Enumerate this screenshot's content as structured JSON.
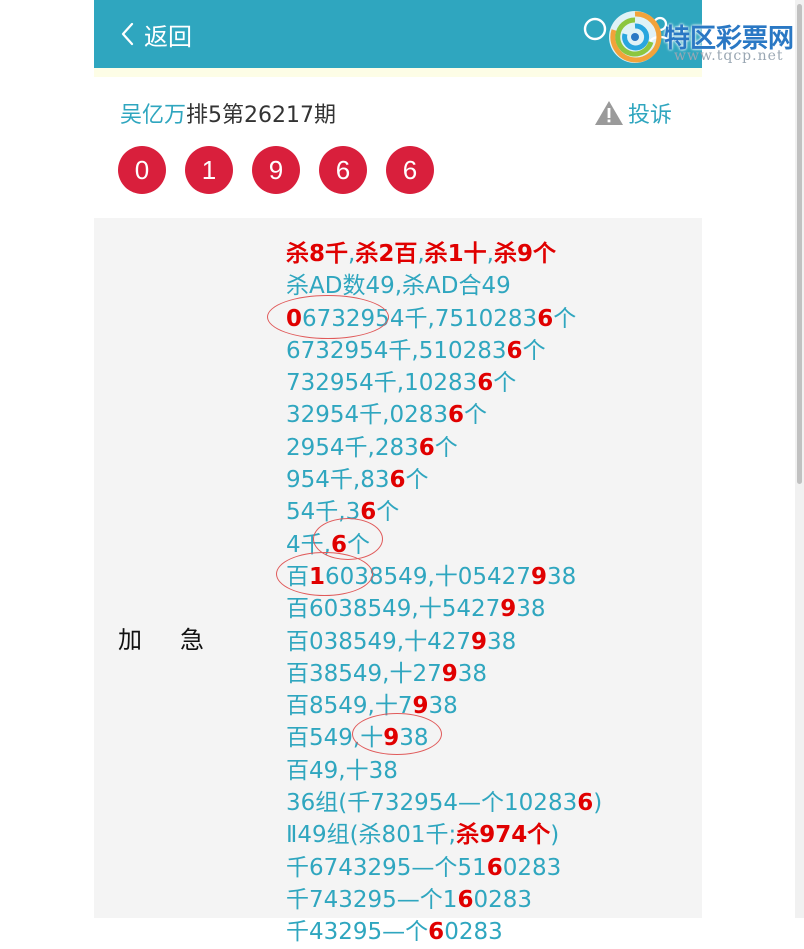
{
  "header": {
    "back_label": "返回",
    "background_color": "#2fa6bf"
  },
  "logo": {
    "title": "特区彩票网",
    "url": "www.tqcp.net"
  },
  "article": {
    "author": "吴亿万",
    "title_suffix": "排5第26217期",
    "complain_label": "投诉"
  },
  "draw_numbers": [
    "0",
    "1",
    "9",
    "6",
    "6"
  ],
  "content": {
    "label": "加急",
    "lines": [
      [
        {
          "t": "杀8千",
          "r": true
        },
        {
          "t": ",",
          "r": false
        },
        {
          "t": "杀2百",
          "r": true
        },
        {
          "t": ",",
          "r": false
        },
        {
          "t": "杀1十",
          "r": true
        },
        {
          "t": ",",
          "r": false
        },
        {
          "t": "杀9个",
          "r": true
        }
      ],
      [
        {
          "t": "杀AD数49,杀AD合49",
          "r": false
        }
      ],
      [
        {
          "t": "0",
          "r": true
        },
        {
          "t": "6732954千,751028 3",
          "r": false
        }
      ],
      [
        {
          "t": "6732954千,510283",
          "r": false
        },
        {
          "t": "6",
          "r": true
        },
        {
          "t": "个",
          "r": false
        }
      ],
      [
        {
          "t": "732954千,10283",
          "r": false
        },
        {
          "t": "6",
          "r": true
        },
        {
          "t": "个",
          "r": false
        }
      ],
      [
        {
          "t": "32954千,0283",
          "r": false
        },
        {
          "t": "6",
          "r": true
        },
        {
          "t": "个",
          "r": false
        }
      ],
      [
        {
          "t": "2954千,283",
          "r": false
        },
        {
          "t": "6",
          "r": true
        },
        {
          "t": "个",
          "r": false
        }
      ],
      [
        {
          "t": "954千,83",
          "r": false
        },
        {
          "t": "6",
          "r": true
        },
        {
          "t": "个",
          "r": false
        }
      ],
      [
        {
          "t": "54千,3",
          "r": false
        },
        {
          "t": "6",
          "r": true
        },
        {
          "t": "个",
          "r": false
        }
      ],
      [
        {
          "t": "4千,",
          "r": false
        },
        {
          "t": "6",
          "r": true
        },
        {
          "t": "个",
          "r": false
        }
      ],
      [
        {
          "t": "百",
          "r": false
        },
        {
          "t": "1",
          "r": true
        },
        {
          "t": "6038549,十05427",
          "r": false
        },
        {
          "t": "9",
          "r": true
        },
        {
          "t": "38",
          "r": false
        }
      ],
      [
        {
          "t": "百6038549,十5427",
          "r": false
        },
        {
          "t": "9",
          "r": true
        },
        {
          "t": "38",
          "r": false
        }
      ],
      [
        {
          "t": "百038549,十427",
          "r": false
        },
        {
          "t": "9",
          "r": true
        },
        {
          "t": "38",
          "r": false
        }
      ],
      [
        {
          "t": "百38549,十27",
          "r": false
        },
        {
          "t": "9",
          "r": true
        },
        {
          "t": "38",
          "r": false
        }
      ],
      [
        {
          "t": "百8549,十7",
          "r": false
        },
        {
          "t": "9",
          "r": true
        },
        {
          "t": "38",
          "r": false
        }
      ],
      [
        {
          "t": "百549,十",
          "r": false
        },
        {
          "t": "9",
          "r": true
        },
        {
          "t": "38",
          "r": false
        }
      ],
      [
        {
          "t": "百49,十38",
          "r": false
        }
      ],
      [
        {
          "t": "36组(千732954—个10283",
          "r": false
        },
        {
          "t": "6",
          "r": true
        },
        {
          "t": ")",
          "r": false
        }
      ],
      [
        {
          "t": "Ⅱ49组(杀801千;",
          "r": false
        },
        {
          "t": "杀974个",
          "r": true
        },
        {
          "t": ")",
          "r": false
        }
      ],
      [
        {
          "t": "千6743295—个51",
          "r": false
        },
        {
          "t": "6",
          "r": true
        },
        {
          "t": "0283",
          "r": false
        }
      ],
      [
        {
          "t": "千743295—个1",
          "r": false
        },
        {
          "t": "6",
          "r": true
        },
        {
          "t": "0283",
          "r": false
        }
      ],
      [
        {
          "t": "千43295—个",
          "r": false
        },
        {
          "t": "6",
          "r": true
        },
        {
          "t": "0283",
          "r": false
        }
      ]
    ]
  }
}
